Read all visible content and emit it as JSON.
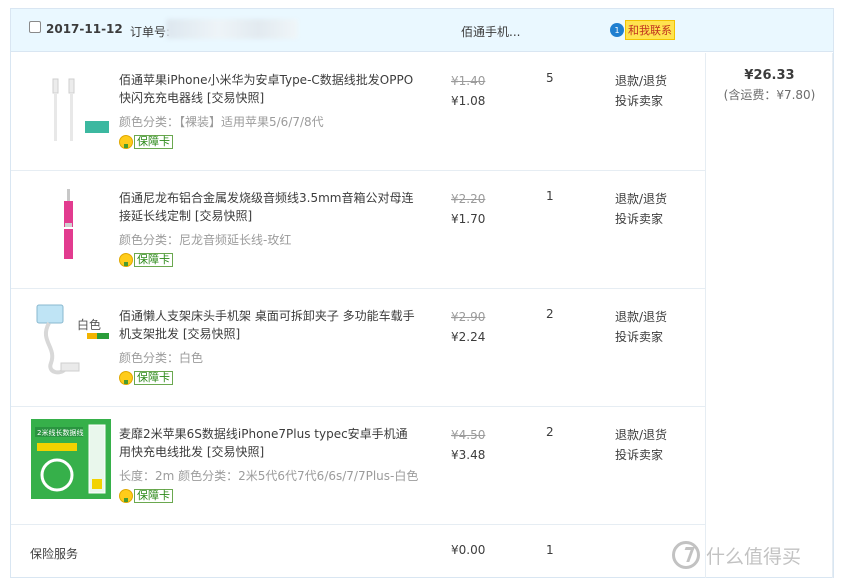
{
  "order": {
    "date": "2017-11-12",
    "order_no_label": "订单号:",
    "shop_name": "佰通手机...",
    "contact_label": "和我联系",
    "contact_icon_text": "1",
    "total": "¥26.33",
    "shipping": "(含运费：¥7.80)"
  },
  "icons": {
    "checkbox": "checkbox-icon",
    "chat": "chat-bubble-icon",
    "badge": "guarantee-card-icon"
  },
  "colors": {
    "header_bg": "#eaf8ff",
    "border": "#d9e6f2",
    "badge_green": "#2d8a1a",
    "contact_bg": "#ffe34f",
    "contact_text": "#c0321f"
  },
  "items": [
    {
      "title": "佰通苹果iPhone小米华为安卓Type-C数据线批发OPPO快闪充充电器线 [交易快照]",
      "sku": "颜色分类：【裸装】适用苹果5/6/7/8代",
      "badge": "保障卡",
      "price_old": "¥1.40",
      "price_new": "¥1.08",
      "qty": "5",
      "op_refund": "退款/退货",
      "op_complain": "投诉卖家"
    },
    {
      "title": "佰通尼龙布铝合金属发烧级音频线3.5mm音箱公对母连接延长线定制 [交易快照]",
      "sku": "颜色分类：尼龙音频延长线-玫红",
      "badge": "保障卡",
      "price_old": "¥2.20",
      "price_new": "¥1.70",
      "qty": "1",
      "op_refund": "退款/退货",
      "op_complain": "投诉卖家"
    },
    {
      "title": "佰通懒人支架床头手机架 桌面可拆卸夹子 多功能车载手机支架批发 [交易快照]",
      "sku": "颜色分类：白色",
      "badge": "保障卡",
      "price_old": "¥2.90",
      "price_new": "¥2.24",
      "qty": "2",
      "op_refund": "退款/退货",
      "op_complain": "投诉卖家",
      "thumb_text": "白色"
    },
    {
      "title": "麦靡2米苹果6S数据线iPhone7Plus typec安卓手机通用快充电线批发 [交易快照]",
      "sku": "长度：2m  颜色分类：2米5代6代7代6/6s/7/7Plus-白色",
      "badge": "保障卡",
      "price_old": "¥4.50",
      "price_new": "¥3.48",
      "qty": "2",
      "op_refund": "退款/退货",
      "op_complain": "投诉卖家",
      "thumb_text": "2米线长数据线"
    }
  ],
  "service": {
    "label": "保险服务",
    "price": "¥0.00",
    "qty": "1"
  },
  "watermark": {
    "text": "什么值得买"
  }
}
